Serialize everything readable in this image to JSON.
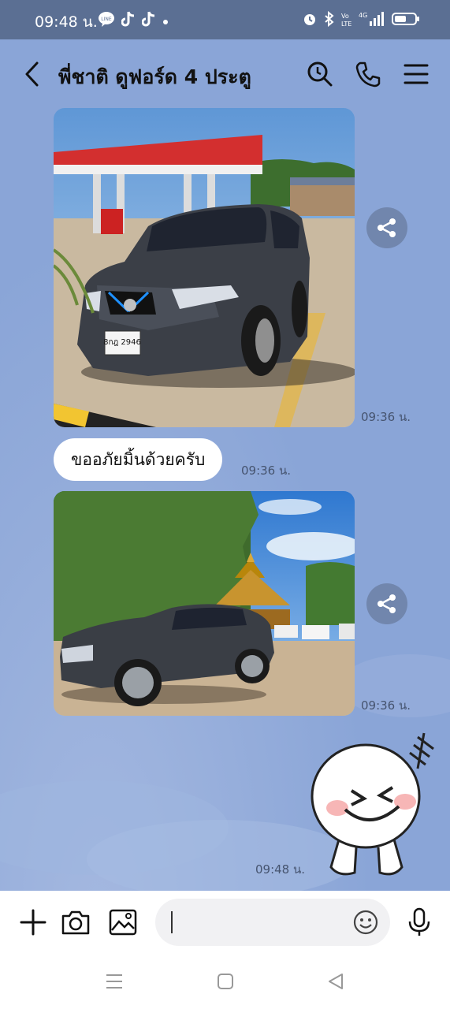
{
  "status_bar": {
    "time": "09:48 น."
  },
  "header": {
    "title": "พี่ชาติ ดูฟอร์ด 4 ประตู"
  },
  "messages": {
    "photo_1_time": "09:36 น.",
    "text_1": "ขออภัยมิ้นด้วยครับ",
    "text_1_time": "09:36 น.",
    "photo_2_time": "09:36 น.",
    "sticker_time": "09:48 น.",
    "plate_text": "8กฎ 2946"
  },
  "colors": {
    "chat_background": "#8aa5d7",
    "status_bar": "#5b6f93",
    "share_button": "#7186ad"
  },
  "icons": [
    "back-arrow",
    "search",
    "phone",
    "menu",
    "share",
    "plus",
    "camera",
    "image",
    "emoji",
    "microphone"
  ]
}
